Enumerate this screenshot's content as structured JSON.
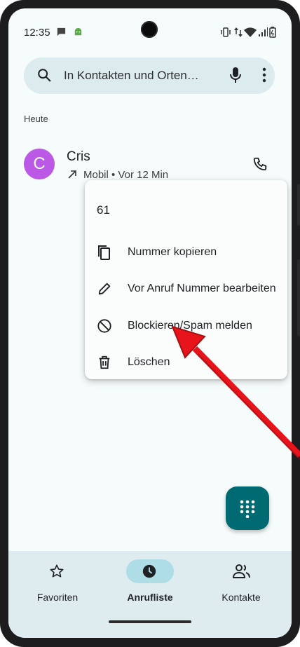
{
  "status_bar": {
    "time": "12:35"
  },
  "search": {
    "placeholder": "In Kontakten und Orten…"
  },
  "section_header": "Heute",
  "call_entry": {
    "avatar_letter": "C",
    "avatar_color": "#bb58e6",
    "name": "Cris",
    "meta": "Mobil • Vor 12 Min"
  },
  "context_menu": {
    "number": "61",
    "items": [
      {
        "label": "Nummer kopieren",
        "icon": "copy-icon"
      },
      {
        "label": "Vor Anruf Nummer bearbeiten",
        "icon": "pencil-icon"
      },
      {
        "label": "Blockieren/Spam melden",
        "icon": "block-icon"
      },
      {
        "label": "Löschen",
        "icon": "trash-icon"
      }
    ]
  },
  "fab": {
    "icon": "dialpad-icon",
    "color": "#006a73"
  },
  "bottom_nav": {
    "items": [
      {
        "label": "Favoriten",
        "icon": "star-icon",
        "active": false
      },
      {
        "label": "Anrufliste",
        "icon": "clock-icon",
        "active": true
      },
      {
        "label": "Kontakte",
        "icon": "people-icon",
        "active": false
      }
    ]
  },
  "colors": {
    "accent": "#006a73",
    "annotation": "#e8141b"
  }
}
